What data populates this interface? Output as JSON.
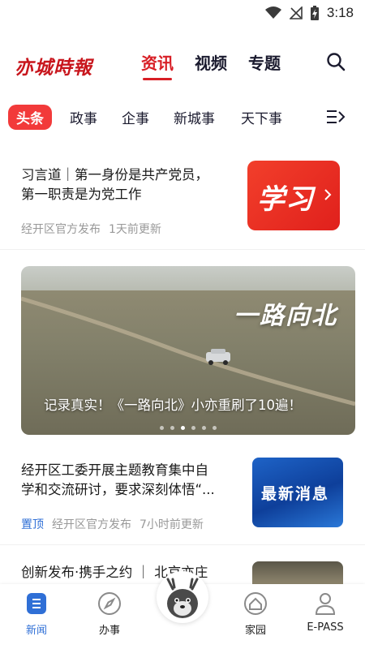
{
  "status_bar": {
    "time": "3:18"
  },
  "header": {
    "logo": "亦城時報",
    "tabs": [
      {
        "label": "资讯",
        "active": true
      },
      {
        "label": "视频",
        "active": false
      },
      {
        "label": "专题",
        "active": false
      }
    ]
  },
  "categories": [
    {
      "label": "头条",
      "active": true
    },
    {
      "label": "政事",
      "active": false
    },
    {
      "label": "企事",
      "active": false
    },
    {
      "label": "新城事",
      "active": false
    },
    {
      "label": "天下事",
      "active": false
    }
  ],
  "feed": {
    "item1": {
      "title_line1": "习言道｜第一身份是共产党员，",
      "title_line2": "第一职责是为党工作",
      "source": "经开区官方发布",
      "time": "1天前更新",
      "thumb_text": "学习"
    },
    "banner": {
      "overlay_title": "一路向北",
      "caption": "记录真实！《一路向北》小亦重刷了10遍！",
      "dot_count": 6,
      "active_dot": 2
    },
    "item2": {
      "title_line1": "经开区工委开展主题教育集中自",
      "title_line2": "学和交流研讨，要求深刻体悟“...",
      "pin": "置顶",
      "source": "经开区官方发布",
      "time": "7小时前更新",
      "thumb_text": "最新消息"
    },
    "item3": {
      "title": "创新发布·携手之约 ｜ 北京亦庄"
    }
  },
  "bottom_nav": {
    "items": [
      {
        "label": "新闻",
        "icon": "news-icon",
        "active": true
      },
      {
        "label": "办事",
        "icon": "compass-icon",
        "active": false
      },
      {
        "label": "家园",
        "icon": "home-icon",
        "active": false
      },
      {
        "label": "E-PASS",
        "icon": "person-icon",
        "active": false
      }
    ]
  },
  "colors": {
    "brand_red": "#d81e25",
    "accent_blue": "#2f6fd6"
  }
}
